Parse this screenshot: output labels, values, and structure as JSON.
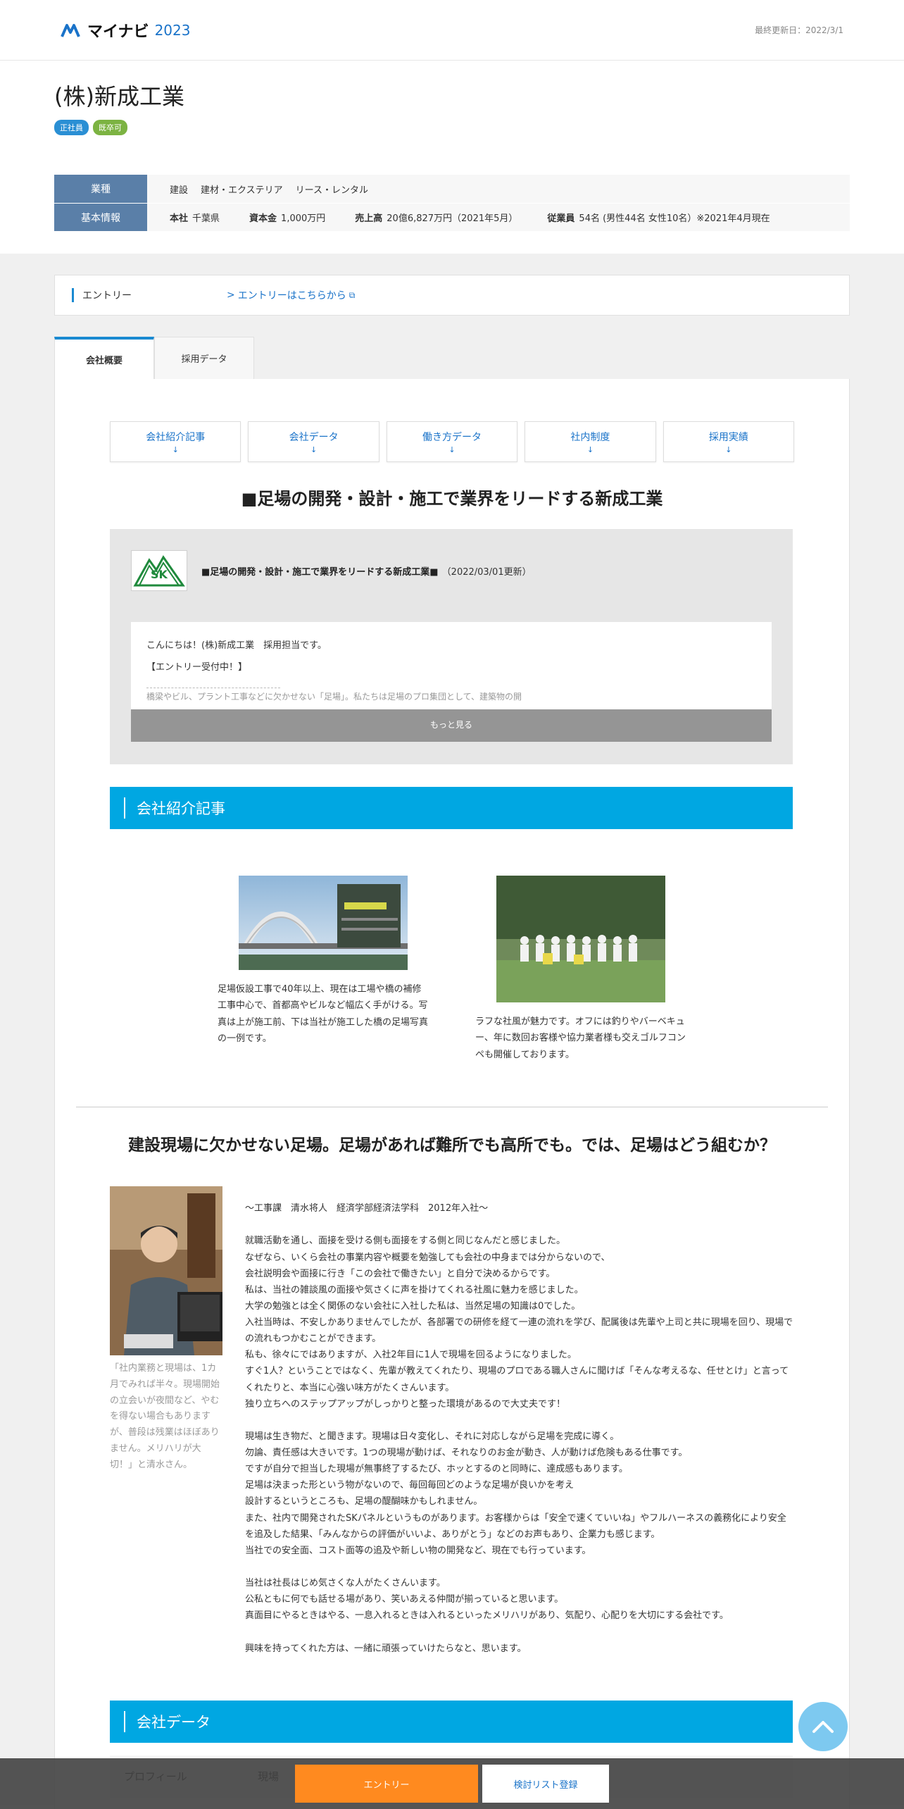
{
  "header": {
    "logo_text": "マイナビ",
    "logo_year": "2023",
    "updated": "最終更新日：2022/3/1"
  },
  "company": {
    "name": "(株)新成工業",
    "badges": [
      "正社員",
      "既卒可"
    ]
  },
  "info": {
    "industry_label": "業種",
    "industry_values": [
      "建設",
      "建材・エクステリア",
      "リース・レンタル"
    ],
    "basic_label": "基本情報",
    "hq_key": "本社",
    "hq_val": "千葉県",
    "capital_key": "資本金",
    "capital_val": "1,000万円",
    "sales_key": "売上高",
    "sales_val": "20億6,827万円（2021年5月）",
    "employees_key": "従業員",
    "employees_val": "54名 (男性44名 女性10名）※2021年4月現在"
  },
  "entry": {
    "label": "エントリー",
    "link": "エントリーはこちらから"
  },
  "tabs": [
    {
      "label": "会社概要",
      "active": true
    },
    {
      "label": "採用データ",
      "active": false
    }
  ],
  "anchors": [
    {
      "label": "会社紹介記事",
      "arrow": "↓"
    },
    {
      "label": "会社データ",
      "arrow": "↓"
    },
    {
      "label": "働き方データ",
      "arrow": "↓"
    },
    {
      "label": "社内制度",
      "arrow": "↓"
    },
    {
      "label": "採用実績",
      "arrow": "↓"
    }
  ],
  "headline": "■足場の開発・設計・施工で業界をリードする新成工業",
  "news": {
    "logo_text": "SK",
    "title": "■足場の開発・設計・施工で業界をリードする新成工業■",
    "date": "（2022/03/01更新）",
    "line1": "こんにちは！(株)新成工業　採用担当です。",
    "line2": "【エントリー受付中！】",
    "cut": "橋梁やビル、プラント工事などに欠かせない「足場」。私たちは足場のプロ集団として、建築物の開",
    "more": "もっと見る"
  },
  "section_intro": "会社紹介記事",
  "photos": [
    {
      "caption": "足場仮設工事で40年以上、現在は工場や橋の補修工事中心で、首都高やビルなど幅広く手がける。写真は上が施工前、下は当社が施工した橋の足場写真の一例です。"
    },
    {
      "caption": "ラフな社風が魅力です。オフには釣りやバーベキュー、年に数回お客様や協力業者様も交えゴルフコンペも開催しております。"
    }
  ],
  "article": {
    "title": "建設現場に欠かせない足場。足場があれば難所でも高所でも。では、足場はどう組むか？",
    "person_caption": "「社内業務と現場は、1カ月でみれば半々。現場開始の立会いが夜間など、やむを得ない場合もありますが、普段は残業はほぼありません。メリハリが大切！」と清水さん。",
    "lines": [
      "～工事課　清水将人　経済学部経済法学科　2012年入社～",
      "",
      "就職活動を通し、面接を受ける側も面接をする側と同じなんだと感じました。",
      "なぜなら、いくら会社の事業内容や概要を勉強しても会社の中身までは分からないので、",
      "会社説明会や面接に行き「この会社で働きたい」と自分で決めるからです。",
      "私は、当社の雑談風の面接や気さくに声を掛けてくれる社風に魅力を感じました。",
      "大学の勉強とは全く関係のない会社に入社した私は、当然足場の知識は0でした。",
      "入社当時は、不安しかありませんでしたが、各部署での研修を経て一連の流れを学び、配属後は先輩や上司と共に現場を回り、現場での流れもつかむことができます。",
      "私も、徐々にではありますが、入社2年目に1人で現場を回るようになりました。",
      "すぐ1人？ということではなく、先輩が教えてくれたり、現場のプロである職人さんに聞けば「そんな考えるな、任せとけ」と言ってくれたりと、本当に心強い味方がたくさんいます。",
      "独り立ちへのステップアップがしっかりと整った環境があるので大丈夫です！",
      "",
      "現場は生き物だ、と聞きます。現場は日々変化し、それに対応しながら足場を完成に導く。",
      "勿論、責任感は大きいです。1つの現場が動けば、それなりのお金が動き、人が動けば危険もある仕事です。",
      "ですが自分で担当した現場が無事終了するたび、ホッとするのと同時に、達成感もあります。",
      "足場は決まった形という物がないので、毎回毎回どのような足場が良いかを考え",
      "設計するというところも、足場の醍醐味かもしれません。",
      "また、社内で開発されたSKパネルというものがあります。お客様からは「安全で速くていいね」やフルハーネスの義務化により安全を追及した結果、「みんなからの評価がいいよ、ありがとう」などのお声もあり、企業力も感じます。",
      "当社での安全面、コスト面等の追及や新しい物の開発など、現在でも行っています。",
      "",
      "当社は社長はじめ気さくな人がたくさんいます。",
      "公私ともに何でも話せる場があり、笑いあえる仲間が揃っていると思います。",
      "真面目にやるときはやる、一息入れるときは入れるといったメリハリがあり、気配り、心配りを大切にする会社です。",
      "",
      "興味を持ってくれた方は、一緒に頑張っていけたらなと、思います。"
    ]
  },
  "section_data": "会社データ",
  "profile": {
    "key": "プロフィール",
    "val": "現場"
  },
  "bottom": {
    "entry": "エントリー",
    "list": "検討リスト登録"
  }
}
